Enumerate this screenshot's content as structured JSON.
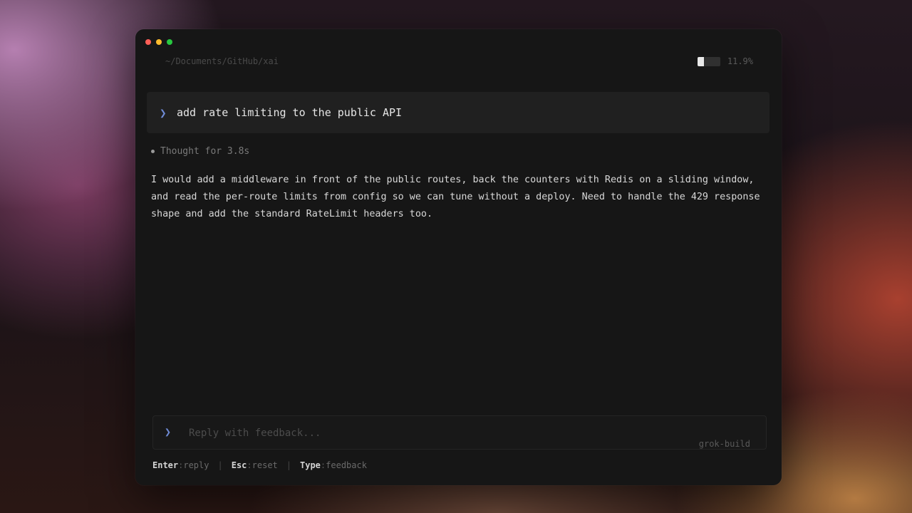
{
  "window": {
    "path": "~/Documents/GitHub/xai",
    "usage": {
      "percent_text": "11.9%",
      "fill_fraction": 0.3
    }
  },
  "prompt": {
    "chevron": "❯",
    "text": "add rate limiting to the public API"
  },
  "thought": {
    "text": "Thought for 3.8s"
  },
  "response": {
    "text": "I would add a middleware in front of the public routes, back the counters with Redis on a sliding window, and read the per-route limits from config so we can tune without a deploy. Need to handle the 429 response shape and add the standard RateLimit headers too."
  },
  "reply": {
    "chevron": "❯",
    "placeholder": "Reply with feedback...",
    "model": "grok-build"
  },
  "hints": [
    {
      "key": "Enter",
      "action": "reply"
    },
    {
      "key": "Esc",
      "action": "reset"
    },
    {
      "key": "Type",
      "action": "feedback"
    }
  ],
  "colors": {
    "accent": "#6f8bd6",
    "close": "#ff5f57",
    "minimize": "#febc2e",
    "maximize": "#28c840"
  }
}
